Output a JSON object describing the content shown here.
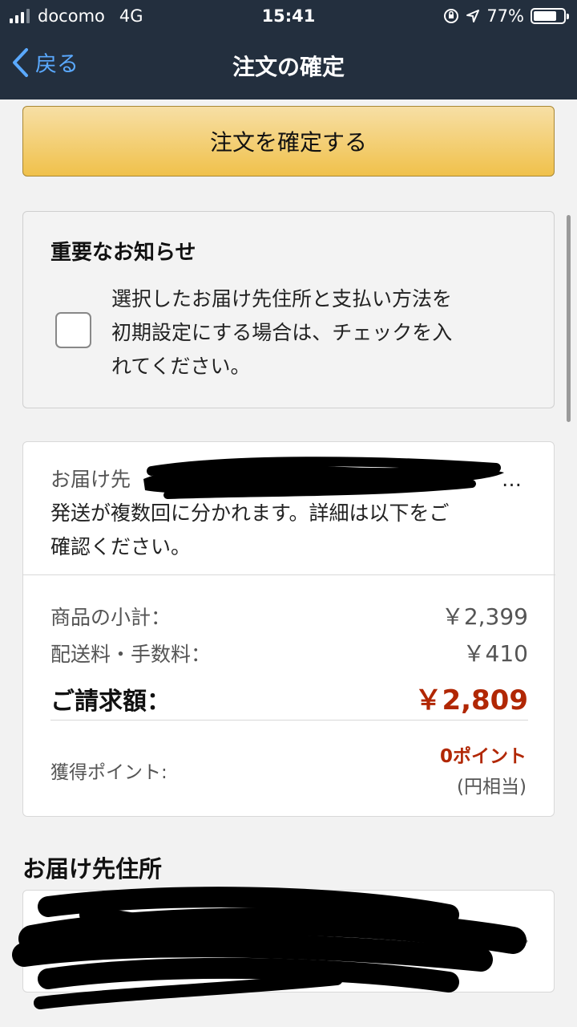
{
  "status_bar": {
    "carrier": "docomo",
    "network": "4G",
    "time": "15:41",
    "battery": "77%",
    "icons": [
      "signal-icon",
      "orientation-lock-icon",
      "location-arrow-icon",
      "battery-icon"
    ]
  },
  "nav": {
    "back_label": "戻る",
    "title": "注文の確定"
  },
  "actions": {
    "confirm_label": "注文を確定する"
  },
  "notice": {
    "title": "重要なお知らせ",
    "checkbox_checked": false,
    "line1": "選択したお届け先住所と支払い方法を",
    "line2": "初期設定にする場合は、チェックを入",
    "line3": "れてください。"
  },
  "summary": {
    "shipping_label": "お届け先",
    "shipping_ellipsis": "…",
    "shipping_line2": "発送が複数回に分かれます。詳細は以下をご",
    "shipping_line3": "確認ください。",
    "subtotal_label": "商品の小計：",
    "subtotal_value": "￥2,399",
    "shipping_fee_label": "配送料・手数料：",
    "shipping_fee_value": "￥410",
    "total_label": "ご請求額：",
    "total_value": "￥2,809",
    "points_label": "獲得ポイント:",
    "points_value": "0ポイント",
    "points_note": "(円相当)"
  },
  "address": {
    "section_title": "お届け先住所",
    "ellipsis": "…"
  },
  "colors": {
    "header_bg": "#232f3e",
    "link_blue": "#5aa9ff",
    "button_yellow": "#f0c14b",
    "price_red": "#b12704"
  }
}
